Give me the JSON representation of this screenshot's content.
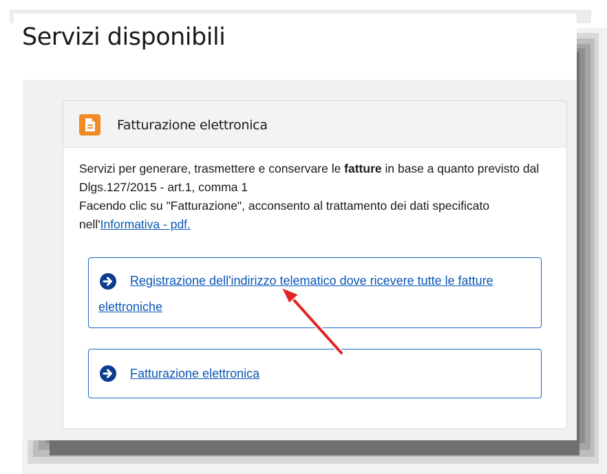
{
  "page": {
    "title": "Servizi disponibili"
  },
  "card": {
    "icon": "document-icon",
    "title": "Fatturazione elettronica",
    "description": {
      "line1_before_bold": "Servizi per generare, trasmettere e conservare le ",
      "line1_bold": "fatture",
      "line1_after_bold": " in base a quanto previsto dal Dlgs.127/2015 - art.1, comma 1",
      "line2": "Facendo clic su \"Fatturazione\", acconsento al trattamento dei dati specificato nell'",
      "informativa_link": "Informativa - pdf."
    },
    "links": [
      {
        "icon": "arrow-right-circle-icon",
        "label": "Registrazione dell'indirizzo telematico dove ricevere tutte le fatture elettroniche"
      },
      {
        "icon": "arrow-right-circle-icon",
        "label": "Fatturazione elettronica"
      }
    ]
  },
  "annotation": {
    "icon": "red-pointer-arrow-icon"
  },
  "colors": {
    "accent_orange": "#f08a24",
    "link_blue": "#0b56b5",
    "link_border": "#1c64c8",
    "annotation_red": "#e02424",
    "panel_bg": "#f1f1f1"
  }
}
